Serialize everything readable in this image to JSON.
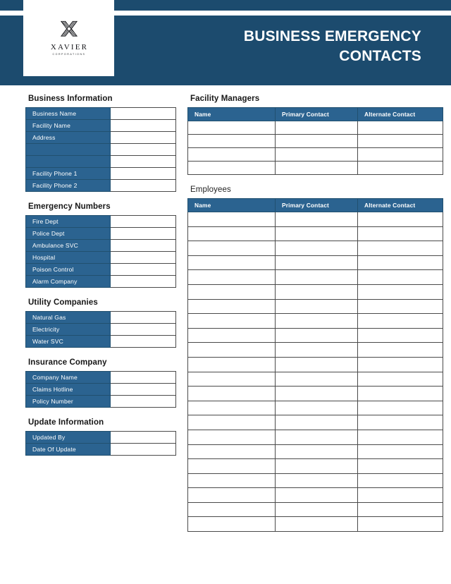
{
  "header": {
    "title_line1": "BUSINESS EMERGENCY",
    "title_line2": "CONTACTS",
    "logo_name": "XAVIER",
    "logo_sub": "CORPORATIONS",
    "logo_icon": "x-monogram-icon"
  },
  "colors": {
    "brand_dark": "#1c4b6e",
    "brand_mid": "#2b6390",
    "border": "#4a4a4a",
    "text": "#171717"
  },
  "left_column": {
    "business_information": {
      "title": "Business Information",
      "rows": [
        {
          "label": "Business Name",
          "value": ""
        },
        {
          "label": "Facility Name",
          "value": ""
        },
        {
          "label": "Address",
          "value": ""
        },
        {
          "label": "",
          "value": ""
        },
        {
          "label": "",
          "value": ""
        },
        {
          "label": "Facility Phone 1",
          "value": ""
        },
        {
          "label": "Facility Phone 2",
          "value": ""
        }
      ]
    },
    "emergency_numbers": {
      "title": "Emergency Numbers",
      "rows": [
        {
          "label": "Fire Dept",
          "value": ""
        },
        {
          "label": "Police Dept",
          "value": ""
        },
        {
          "label": "Ambulance SVC",
          "value": ""
        },
        {
          "label": "Hospital",
          "value": ""
        },
        {
          "label": "Poison Control",
          "value": ""
        },
        {
          "label": "Alarm Company",
          "value": ""
        }
      ]
    },
    "utility_companies": {
      "title": "Utility Companies",
      "rows": [
        {
          "label": "Natural Gas",
          "value": ""
        },
        {
          "label": "Electricity",
          "value": ""
        },
        {
          "label": "Water SVC",
          "value": ""
        }
      ]
    },
    "insurance_company": {
      "title": "Insurance Company",
      "rows": [
        {
          "label": "Company Name",
          "value": ""
        },
        {
          "label": "Claims Hotline",
          "value": ""
        },
        {
          "label": "Policy Number",
          "value": ""
        }
      ]
    },
    "update_information": {
      "title": "Update Information",
      "rows": [
        {
          "label": "Updated By",
          "value": ""
        },
        {
          "label": "Date Of Update",
          "value": ""
        }
      ]
    }
  },
  "right_column": {
    "facility_managers": {
      "title": "Facility  Managers",
      "columns": [
        "Name",
        "Primary Contact",
        "Alternate Contact"
      ],
      "rows": [
        [
          "",
          "",
          ""
        ],
        [
          "",
          "",
          ""
        ],
        [
          "",
          "",
          ""
        ],
        [
          "",
          "",
          ""
        ]
      ]
    },
    "employees": {
      "title": "Employees",
      "columns": [
        "Name",
        "Primary Contact",
        "Alternate Contact"
      ],
      "rows": [
        [
          "",
          "",
          ""
        ],
        [
          "",
          "",
          ""
        ],
        [
          "",
          "",
          ""
        ],
        [
          "",
          "",
          ""
        ],
        [
          "",
          "",
          ""
        ],
        [
          "",
          "",
          ""
        ],
        [
          "",
          "",
          ""
        ],
        [
          "",
          "",
          ""
        ],
        [
          "",
          "",
          ""
        ],
        [
          "",
          "",
          ""
        ],
        [
          "",
          "",
          ""
        ],
        [
          "",
          "",
          ""
        ],
        [
          "",
          "",
          ""
        ],
        [
          "",
          "",
          ""
        ],
        [
          "",
          "",
          ""
        ],
        [
          "",
          "",
          ""
        ],
        [
          "",
          "",
          ""
        ],
        [
          "",
          "",
          ""
        ],
        [
          "",
          "",
          ""
        ],
        [
          "",
          "",
          ""
        ],
        [
          "",
          "",
          ""
        ],
        [
          "",
          "",
          ""
        ]
      ]
    }
  }
}
